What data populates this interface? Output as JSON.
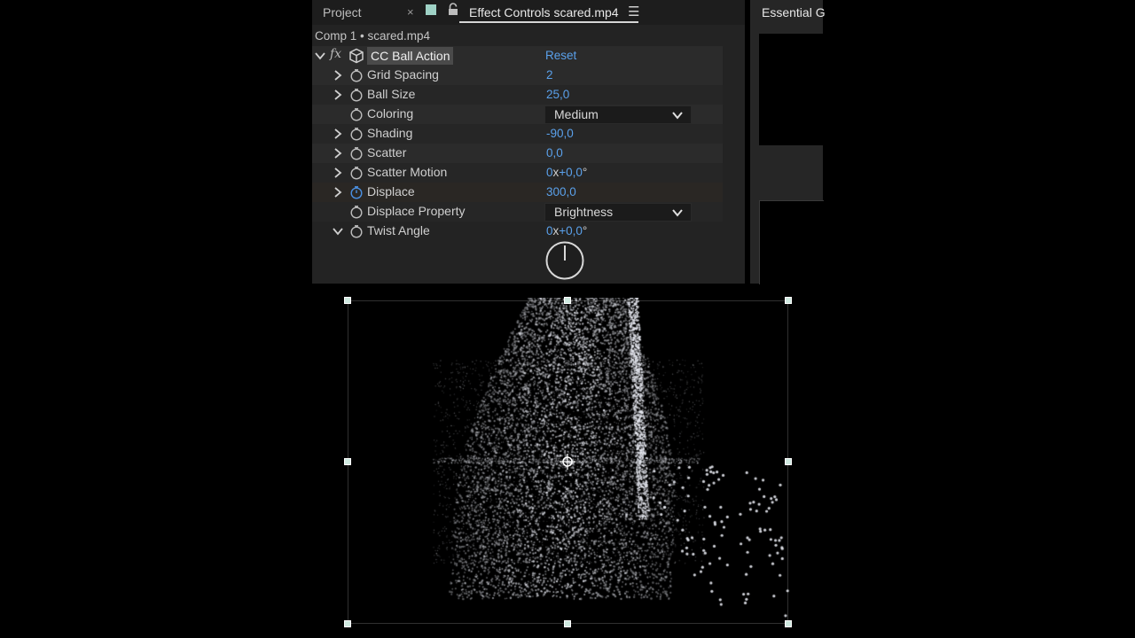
{
  "tabs": {
    "project_label": "Project",
    "close_glyph": "×",
    "active_label": "Effect Controls scared.mp4",
    "menu_glyph": "☰",
    "swatch_color": "#9fd2c6"
  },
  "breadcrumb": "Comp 1 • scared.mp4",
  "effect": {
    "fx_label": "fx",
    "name": "CC Ball Action",
    "reset_label": "Reset"
  },
  "properties": [
    {
      "name": "Grid Spacing",
      "value": "2"
    },
    {
      "name": "Ball Size",
      "value": "25,0"
    },
    {
      "name": "Coloring",
      "dropdown": "Medium"
    },
    {
      "name": "Shading",
      "value": "-90,0"
    },
    {
      "name": "Scatter",
      "value": "0,0"
    },
    {
      "name": "Scatter Motion",
      "value_a": "0",
      "unit_x": "x",
      "value_b": "+0,0",
      "unit_deg": "°"
    },
    {
      "name": "Displace",
      "value": "300,0"
    },
    {
      "name": "Displace Property",
      "dropdown": "Brightness"
    },
    {
      "name": "Twist Angle",
      "value_a": "0",
      "unit_x": "x",
      "value_b": "+0,0",
      "unit_deg": "°"
    }
  ],
  "right_panel": {
    "title": "Essential G"
  },
  "colors": {
    "value_blue": "#5aa0ea",
    "panel_bg": "#232323"
  }
}
